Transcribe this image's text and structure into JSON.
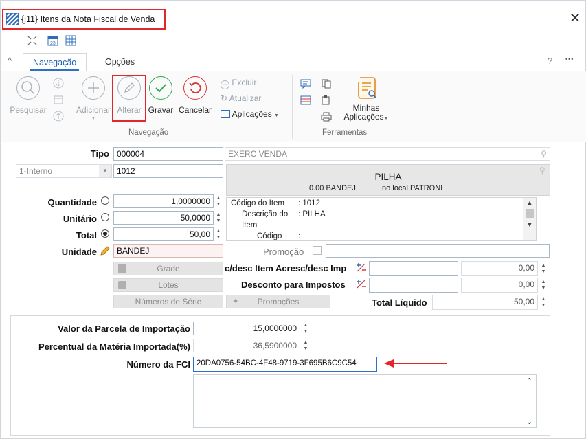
{
  "window": {
    "title": "{j11}  Itens da Nota Fiscal de Venda",
    "close_glyph": "✕",
    "icons": [
      "grid-app-icon",
      "close-icon",
      "collapse-icon",
      "calendar-icon",
      "table-grid-icon"
    ]
  },
  "ribbon": {
    "tabs": [
      {
        "label": "Navegação",
        "active": true
      },
      {
        "label": "Opções",
        "active": false
      }
    ],
    "help_glyph": "?",
    "more_glyph": "•••",
    "collapse_glyph": "^",
    "buttons": {
      "pesquisar": "Pesquisar",
      "adicionar": "Adicionar",
      "alterar": "Alterar",
      "gravar": "Gravar",
      "cancelar": "Cancelar",
      "excluir": "Excluir",
      "atualizar": "Atualizar",
      "aplicacoes": "Aplicações",
      "minhas_aplicacoes_1": "Minhas",
      "minhas_aplicacoes_2": "Aplicações"
    },
    "groups": {
      "navegacao": "Navegação",
      "ferramentas": "Ferramentas"
    }
  },
  "form": {
    "tipo_label": "Tipo",
    "tipo_code": "000004",
    "tipo_desc": "EXERC VENDA",
    "origem_value": "1-Interno",
    "item_code": "1012",
    "product_panel": {
      "name": "PILHA",
      "stock_qty": "0.00 BANDEJ",
      "stock_location": "no local PATRONI",
      "details": [
        {
          "key": "Código do Item",
          "value": ": 1012"
        },
        {
          "key": "Descrição do",
          "value": ": PILHA"
        },
        {
          "key": "Item",
          "value": ""
        },
        {
          "key": "Código",
          "value": ":"
        }
      ]
    },
    "quantidade_label": "Quantidade",
    "quantidade_value": "1,0000000",
    "unitario_label": "Unitário",
    "unitario_value": "50,0000",
    "total_label": "Total",
    "total_value": "50,00",
    "unidade_label": "Unidade",
    "unidade_value": "BANDEJ",
    "promocao_label": "Promoção",
    "grade_label": "Grade",
    "lotes_label": "Lotes",
    "numeros_serie_label": "Números de Série",
    "promocoes_label": "Promoções",
    "acresc_label": "c/desc Item Acresc/desc Imp",
    "acresc_value": "0,00",
    "desconto_impostos_label": "Desconto para Impostos",
    "desconto_impostos_value": "0,00",
    "total_liquido_label": "Total Líquido",
    "total_liquido_value": "50,00"
  },
  "import_section": {
    "parcela_label": "Valor da Parcela de Importação",
    "parcela_value": "15,0000000",
    "percentual_label": "Percentual da Matéria Importada(%)",
    "percentual_value": "36,5900000",
    "fci_label": "Número da FCI",
    "fci_value": "20DA0756-54BC-4F48-9719-3F695B6C9C54"
  },
  "colors": {
    "highlight": "#e0272b",
    "accent": "#2d6fc0",
    "gravar_green": "#2dab4f",
    "cancelar_red": "#d8373a"
  }
}
